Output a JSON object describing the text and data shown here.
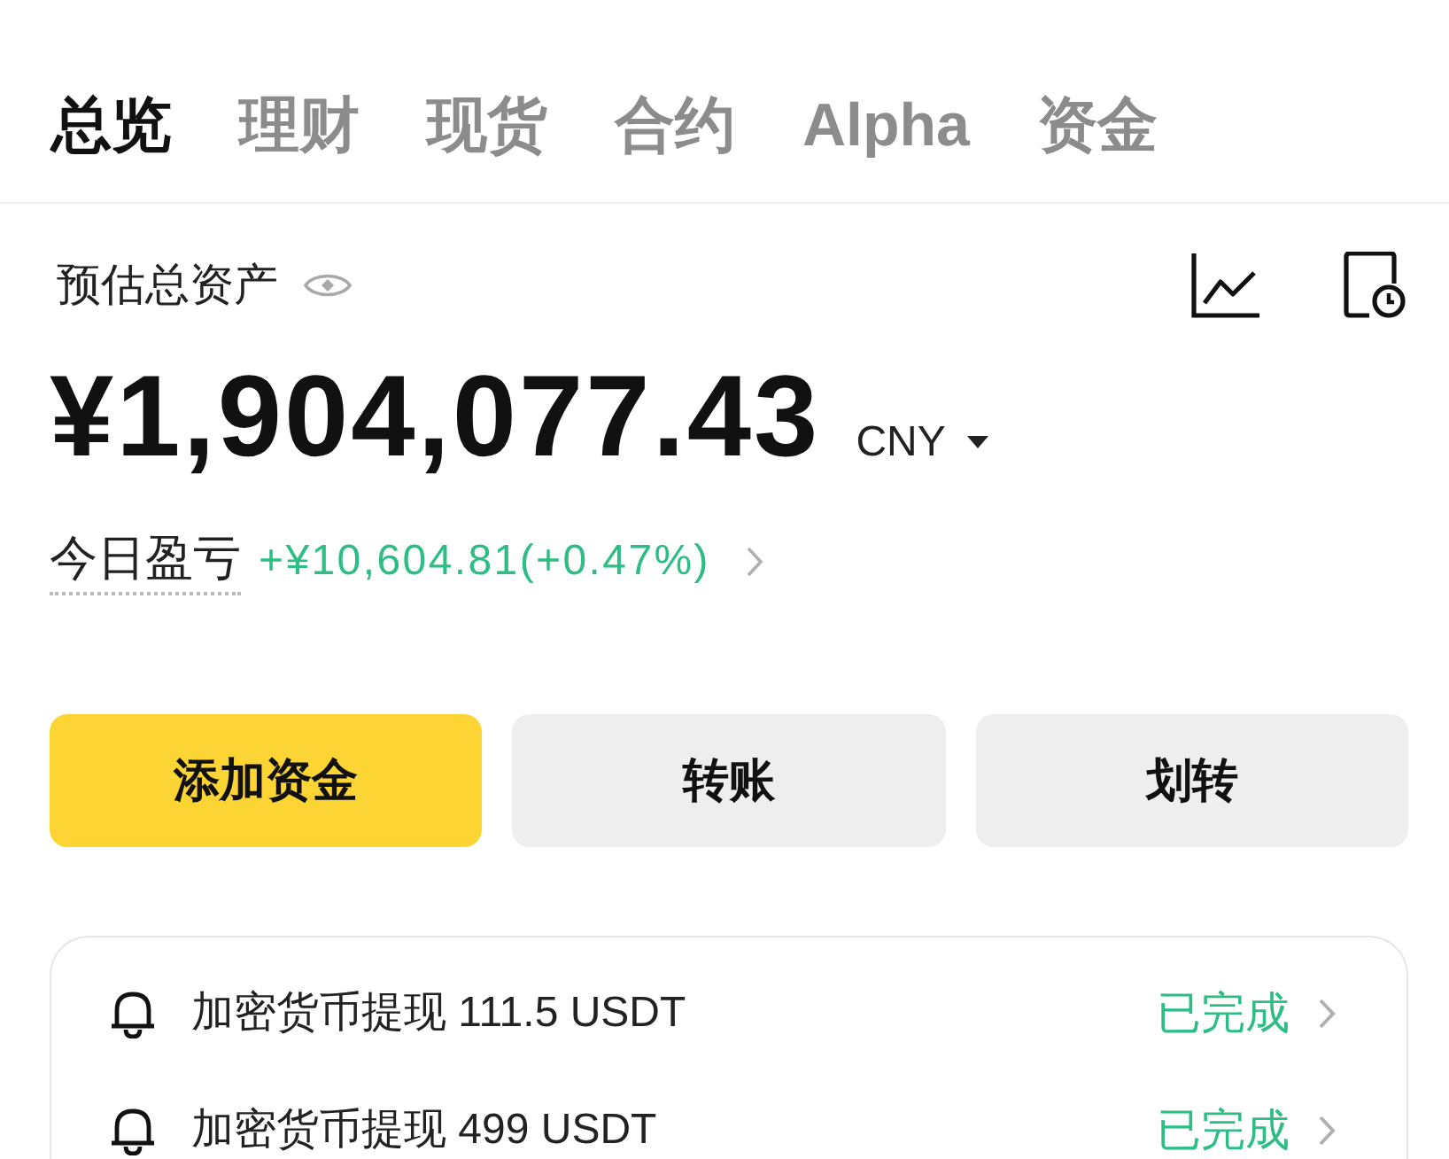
{
  "tabs": [
    {
      "label": "总览",
      "selected": true
    },
    {
      "label": "理财",
      "selected": false
    },
    {
      "label": "现货",
      "selected": false
    },
    {
      "label": "合约",
      "selected": false
    },
    {
      "label": "Alpha",
      "selected": false
    },
    {
      "label": "资金",
      "selected": false
    }
  ],
  "assets": {
    "label": "预估总资产",
    "amount": "¥1,904,077.43",
    "currency": "CNY"
  },
  "pnl": {
    "label": "今日盈亏",
    "value": "+¥10,604.81(+0.47%)"
  },
  "actions": [
    {
      "label": "添加资金",
      "kind": "primary"
    },
    {
      "label": "转账",
      "kind": "secondary"
    },
    {
      "label": "划转",
      "kind": "secondary"
    }
  ],
  "notifications": [
    {
      "text": "加密货币提现 111.5 USDT",
      "status": "已完成"
    },
    {
      "text": "加密货币提现 499 USDT",
      "status": "已完成"
    }
  ]
}
